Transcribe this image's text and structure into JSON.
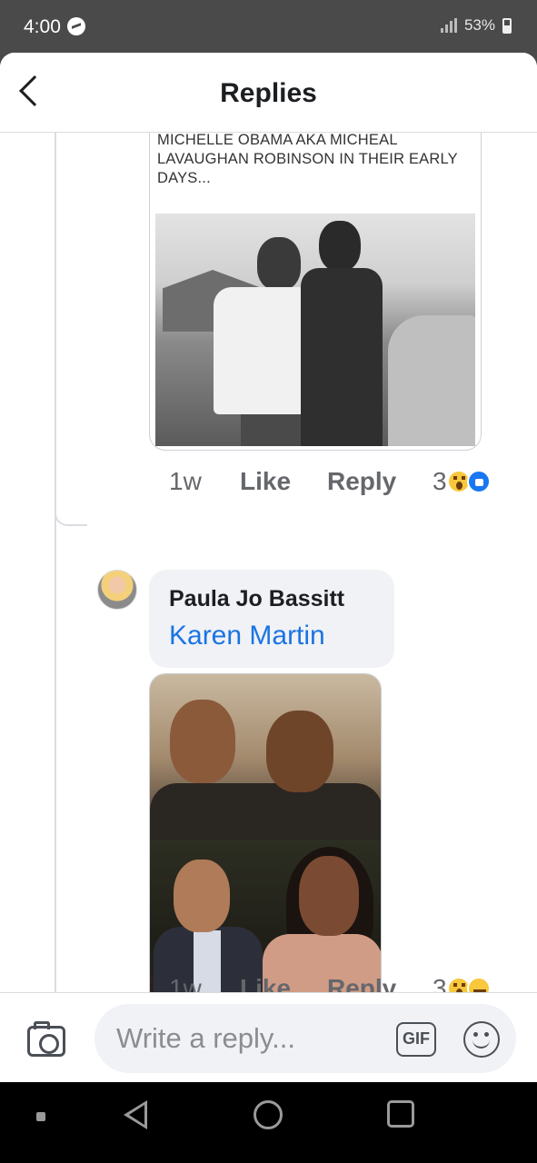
{
  "status_bar": {
    "time": "4:00",
    "battery": "53%"
  },
  "header": {
    "title": "Replies"
  },
  "meme": {
    "caption": "BARRY SOTERO AKA BARRACK AND MICHELLE OBAMA AKA MICHEAL LAVAUGHAN ROBINSON IN THEIR EARLY DAYS..."
  },
  "comments": [
    {
      "time": "1w",
      "like_label": "Like",
      "reply_label": "Reply",
      "reaction_count": "3",
      "reactions": [
        "wow-icon",
        "like-icon"
      ]
    },
    {
      "author": "Paula Jo Bassitt",
      "mention": "Karen Martin",
      "time": "1w",
      "like_label": "Like",
      "reply_label": "Reply",
      "reaction_count": "3",
      "reactions": [
        "wow-icon",
        "haha-icon"
      ]
    }
  ],
  "composer": {
    "placeholder": "Write a reply...",
    "gif_label": "GIF"
  },
  "colors": {
    "accent": "#1b74e4",
    "bubble": "#f0f2f5",
    "meta": "#65676b"
  }
}
